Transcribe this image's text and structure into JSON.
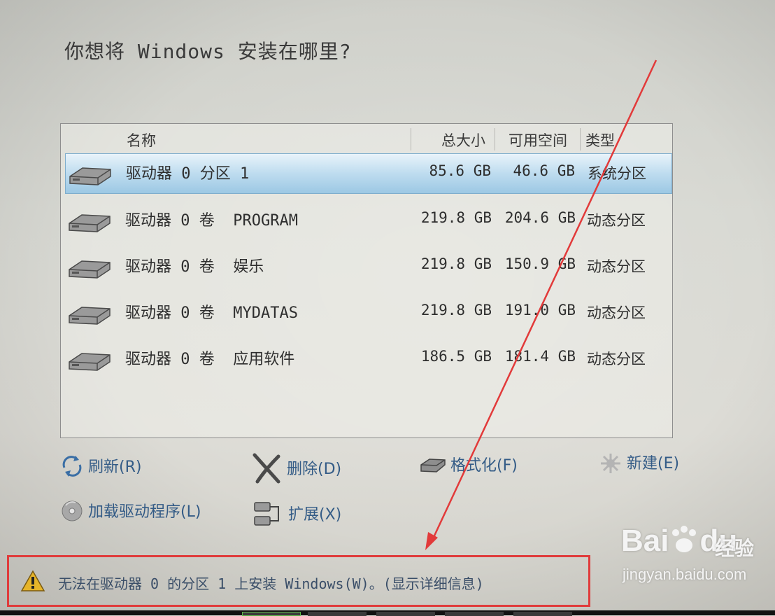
{
  "title": "你想将 Windows 安装在哪里?",
  "table": {
    "columns": {
      "name": "名称",
      "size": "总大小",
      "free": "可用空间",
      "type": "类型"
    },
    "rows": [
      {
        "name": "驱动器 0 分区 1",
        "size": "85.6 GB",
        "free": "46.6 GB",
        "type": "系统分区",
        "selected": true
      },
      {
        "name": "驱动器 0 卷  PROGRAM",
        "size": "219.8 GB",
        "free": "204.6 GB",
        "type": "动态分区"
      },
      {
        "name": "驱动器 0 卷  娱乐",
        "size": "219.8 GB",
        "free": "150.9 GB",
        "type": "动态分区"
      },
      {
        "name": "驱动器 0 卷  MYDATAS",
        "size": "219.8 GB",
        "free": "191.0 GB",
        "type": "动态分区"
      },
      {
        "name": "驱动器 0 卷  应用软件",
        "size": "186.5 GB",
        "free": "181.4 GB",
        "type": "动态分区"
      }
    ]
  },
  "actions": {
    "refresh": "刷新(R)",
    "delete": "删除(D)",
    "format": "格式化(F)",
    "new": "新建(E)",
    "load_driver": "加载驱动程序(L)",
    "extend": "扩展(X)"
  },
  "warning": {
    "message": "无法在驱动器 0 的分区 1 上安装 Windows(W)。(显示详细信息)"
  },
  "watermark": {
    "brand": "Bai",
    "brand2": "du",
    "site": "经验",
    "url": "jingyan.baidu.com"
  },
  "colors": {
    "highlight": "#e03b3b",
    "link": "#335b86",
    "selection": "#bedcef"
  }
}
